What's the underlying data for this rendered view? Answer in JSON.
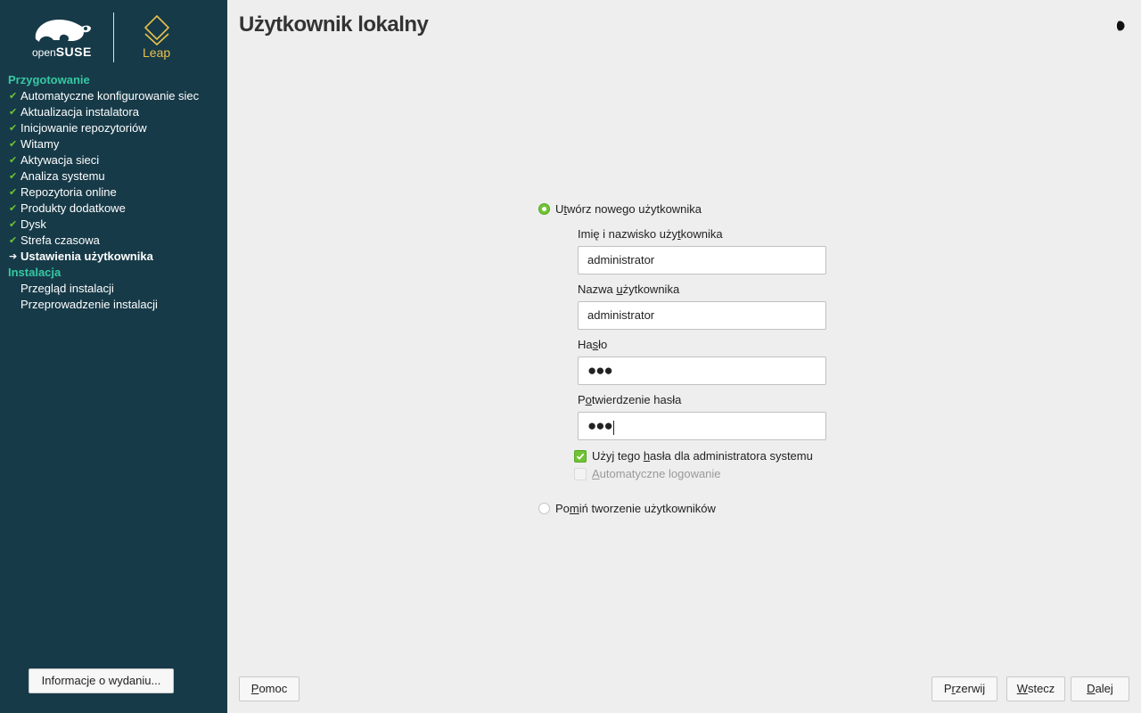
{
  "branding": {
    "opensuse_prefix": "open",
    "opensuse_name": "SUSE",
    "leap_label": "Leap"
  },
  "sidebar": {
    "groups": [
      {
        "title": "Przygotowanie",
        "steps": [
          {
            "label": "Automatyczne konfigurowanie siec",
            "state": "done"
          },
          {
            "label": "Aktualizacja instalatora",
            "state": "done"
          },
          {
            "label": "Inicjowanie repozytoriów",
            "state": "done"
          },
          {
            "label": "Witamy",
            "state": "done"
          },
          {
            "label": "Aktywacja sieci",
            "state": "done"
          },
          {
            "label": "Analiza systemu",
            "state": "done"
          },
          {
            "label": "Repozytoria online",
            "state": "done"
          },
          {
            "label": "Produkty dodatkowe",
            "state": "done"
          },
          {
            "label": "Dysk",
            "state": "done"
          },
          {
            "label": "Strefa czasowa",
            "state": "done"
          },
          {
            "label": "Ustawienia użytkownika",
            "state": "current"
          }
        ]
      },
      {
        "title": "Instalacja",
        "steps": [
          {
            "label": "Przegląd instalacji",
            "state": "pending"
          },
          {
            "label": "Przeprowadzenie instalacji",
            "state": "pending"
          }
        ]
      }
    ],
    "release_notes_button": "Informacje o wydaniu..."
  },
  "page": {
    "title": "Użytkownik lokalny",
    "theme_toggle_icon": "half-moon-icon"
  },
  "form": {
    "create_user_option": {
      "label_pre": "U",
      "label_accel": "t",
      "label_post": "wórz nowego użytkownika",
      "selected": true
    },
    "full_name": {
      "label_pre": "Imię i nazwisko uży",
      "label_accel": "t",
      "label_post": "kownika",
      "value": "administrator"
    },
    "username": {
      "label_pre": "Nazwa ",
      "label_accel": "u",
      "label_post": "żytkownika",
      "value": "administrator"
    },
    "password": {
      "label_pre": "Ha",
      "label_accel": "s",
      "label_post": "ło",
      "masked_value": "●●●"
    },
    "confirm_password": {
      "label_pre": "P",
      "label_accel": "o",
      "label_post": "twierdzenie hasła",
      "masked_value": "●●●"
    },
    "use_for_admin": {
      "label_pre": "Użyj tego ",
      "label_accel": "h",
      "label_post": "asła dla administratora systemu",
      "checked": true
    },
    "auto_login": {
      "label_pre": "",
      "label_accel": "A",
      "label_post": "utomatyczne logowanie",
      "checked": false,
      "enabled": false
    },
    "skip_user_option": {
      "label_pre": "Po",
      "label_accel": "m",
      "label_post": "iń tworzenie użytkowników",
      "selected": false
    }
  },
  "footer": {
    "help": {
      "accel": "P",
      "rest": "omoc"
    },
    "abort": {
      "pre": "P",
      "accel": "r",
      "post": "zerwij"
    },
    "back": {
      "accel": "W",
      "rest": "stecz"
    },
    "next": {
      "accel": "D",
      "rest": "alej"
    }
  },
  "colors": {
    "sidebar_bg": "#173a48",
    "group_title": "#35c9a4",
    "accent_green": "#6ec432",
    "leap_gold": "#e8c14d",
    "content_bg": "#eeeeee"
  }
}
